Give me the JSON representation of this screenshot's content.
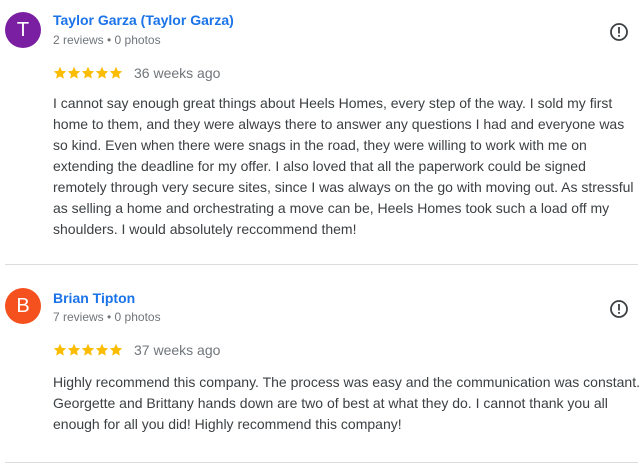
{
  "reviews": [
    {
      "avatar_letter": "T",
      "avatar_color": "#7b1fa2",
      "name": "Taylor Garza (Taylor Garza)",
      "meta": "2 reviews • 0 photos",
      "rating": 5,
      "max_rating": 5,
      "date": "36 weeks ago",
      "text": "I cannot say enough great things about Heels Homes, every step of the way. I sold my first home to them, and they were always there to answer any questions I had and everyone was so kind. Even when there were snags in the road, they were willing to work with me on extending the deadline for my offer. I also loved that all the paperwork could be signed remotely through very secure sites, since I was always on the go with moving out. As stressful as selling a home and orchestrating a move can be, Heels Homes took such a load off my shoulders. I would absolutely reccommend them!"
    },
    {
      "avatar_letter": "B",
      "avatar_color": "#f4511e",
      "name": "Brian Tipton",
      "meta": "7 reviews • 0 photos",
      "rating": 5,
      "max_rating": 5,
      "date": "37 weeks ago",
      "text": "Highly recommend this company. The process was easy and the communication was constant. Georgette and Brittany hands down are two of best at what they do. I cannot thank you all enough for all you did! Highly recommend this company!"
    }
  ],
  "colors": {
    "name_link": "#1a73e8",
    "star": "#fbbc04",
    "meta": "#70757a",
    "body_text": "#3c4043",
    "divider": "#dadce0"
  },
  "icons": {
    "flag": "report-flag-icon",
    "star": "star-icon"
  }
}
